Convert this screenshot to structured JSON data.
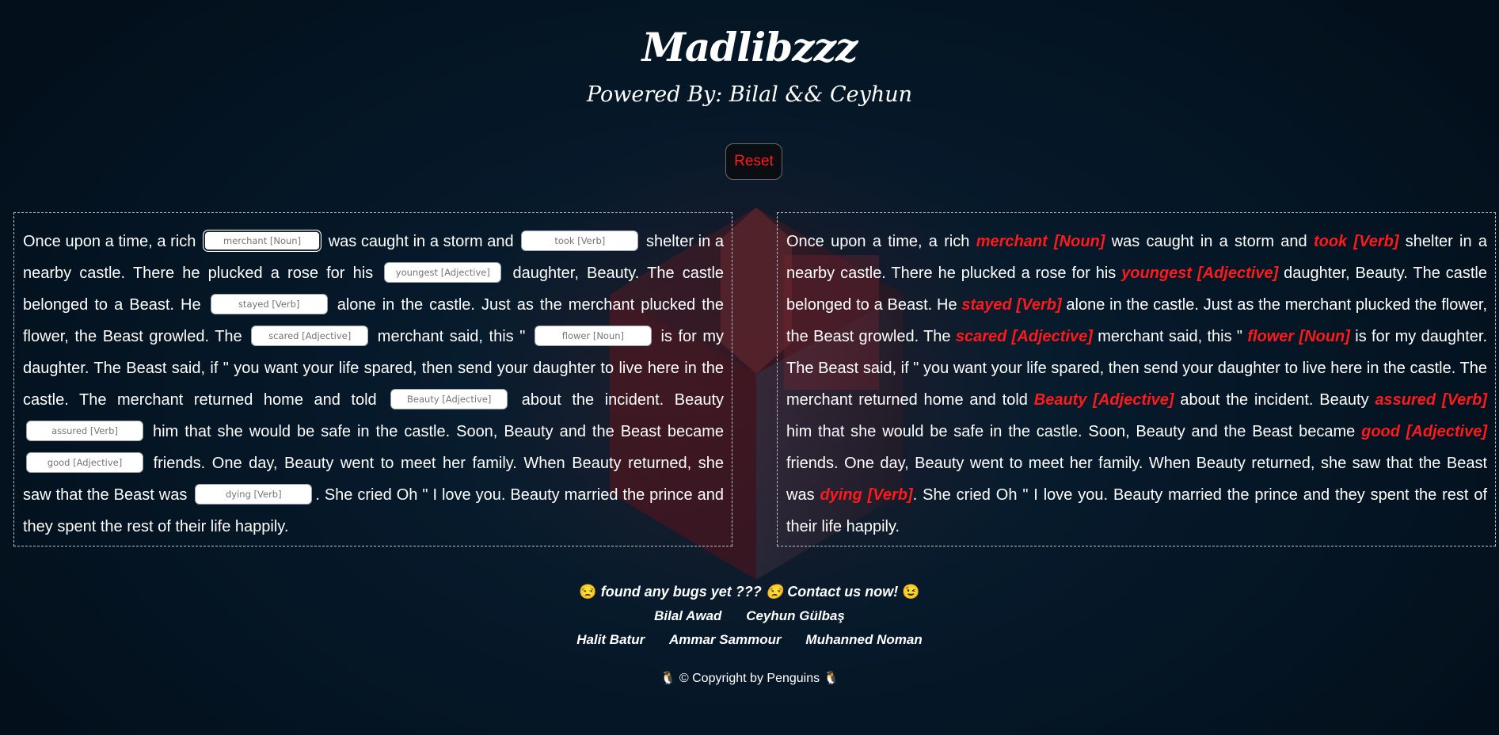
{
  "header": {
    "title": "Madlibzzz",
    "subtitle": "Powered By: Bilal && Ceyhun"
  },
  "reset_label": "Reset",
  "story": {
    "segments_text": [
      "Once upon a time, a rich",
      "was caught in a storm and",
      "shelter in a nearby castle. There he plucked a rose for his",
      "daughter, Beauty. The castle belonged to a Beast. He",
      "alone in the castle. Just as the merchant plucked the flower, the Beast growled. The",
      "merchant said, this \"",
      "is for my daughter. The Beast said, if \" you want your life spared, then send your daughter to live here in the castle. The merchant returned home and told",
      "about the incident. Beauty",
      "him that she would be safe in the castle. Soon, Beauty and the Beast became",
      "friends. One day, Beauty went to meet her family. When Beauty returned, she saw that the Beast was",
      ". She cried Oh \" I love you. Beauty married the prince and they spent the rest of their life happily."
    ],
    "blanks": [
      {
        "placeholder": "merchant [Noun]",
        "filled": "merchant [Noun]"
      },
      {
        "placeholder": "took [Verb]",
        "filled": "took [Verb]"
      },
      {
        "placeholder": "youngest [Adjective]",
        "filled": "youngest [Adjective]"
      },
      {
        "placeholder": "stayed [Verb]",
        "filled": "stayed [Verb]"
      },
      {
        "placeholder": "scared [Adjective]",
        "filled": "scared [Adjective]"
      },
      {
        "placeholder": "flower [Noun]",
        "filled": "flower [Noun]"
      },
      {
        "placeholder": "Beauty [Adjective]",
        "filled": "Beauty [Adjective]"
      },
      {
        "placeholder": "assured [Verb]",
        "filled": "assured [Verb]"
      },
      {
        "placeholder": "good [Adjective]",
        "filled": "good [Adjective]"
      },
      {
        "placeholder": "dying [Verb]",
        "filled": "dying [Verb]"
      }
    ]
  },
  "footer": {
    "contact": "found any bugs yet ??? 😒 Contact us now!",
    "contact_emoji_left": "😒",
    "contact_emoji_right": "😉",
    "team_row1": [
      "Bilal Awad",
      "Ceyhun Gülbaş"
    ],
    "team_row2": [
      "Halit Batur",
      "Ammar Sammour",
      "Muhanned Noman"
    ],
    "copyright": "© Copyright by Penguins",
    "penguin": "🐧"
  },
  "colors": {
    "accent_red": "#ff1a1a",
    "background": "#06192a"
  }
}
